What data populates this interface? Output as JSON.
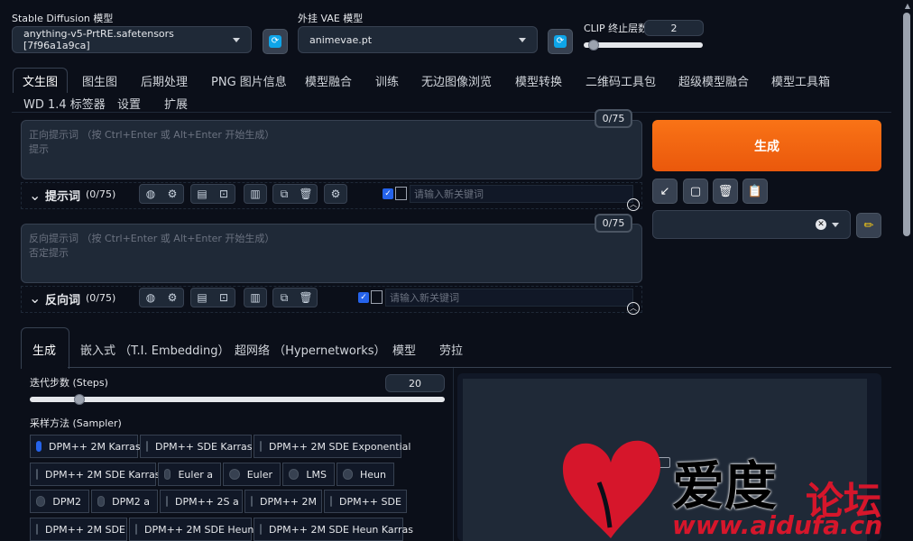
{
  "model": {
    "label": "Stable Diffusion 模型",
    "value": "anything-v5-PrtRE.safetensors [7f96a1a9ca]"
  },
  "vae": {
    "label": "外挂 VAE 模型",
    "value": "animevae.pt"
  },
  "clip": {
    "label": "CLIP 终止层数",
    "value": "2"
  },
  "tabs": [
    "文生图",
    "图生图",
    "后期处理",
    "PNG 图片信息",
    "模型融合",
    "训练",
    "无边图像浏览",
    "模型转换",
    "二维码工具包",
    "超级模型融合",
    "模型工具箱",
    "WD 1.4 标签器",
    "设置",
    "扩展"
  ],
  "prompt": {
    "placeholder_line1": "正向提示词 （按 Ctrl+Enter 或 Alt+Enter 开始生成）",
    "placeholder_line2": "提示",
    "counter": "0/75",
    "title": "提示词",
    "count": "(0/75)",
    "keyword_placeholder": "请输入新关键词"
  },
  "negative": {
    "placeholder_line1": "反向提示词 （按 Ctrl+Enter 或 Alt+Enter 开始生成）",
    "placeholder_line2": "否定提示",
    "counter": "0/75",
    "title": "反向词",
    "count": "(0/75)",
    "keyword_placeholder": "请输入新关键词"
  },
  "generate_label": "生成",
  "subtabs": [
    "生成",
    "嵌入式 （T.I. Embedding）",
    "超网络 （Hypernetworks）",
    "模型",
    "劳拉"
  ],
  "steps": {
    "label": "迭代步数 (Steps)",
    "value": "20",
    "fraction": 0.12
  },
  "sampler": {
    "label": "采样方法 (Sampler)",
    "options": [
      "DPM++ 2M Karras",
      "DPM++ SDE Karras",
      "DPM++ 2M SDE Exponential",
      "DPM++ 2M SDE Karras",
      "Euler a",
      "Euler",
      "LMS",
      "Heun",
      "DPM2",
      "DPM2 a",
      "DPM++ 2S a",
      "DPM++ 2M",
      "DPM++ SDE",
      "DPM++ 2M SDE",
      "DPM++ 2M SDE Heun",
      "DPM++ 2M SDE Heun Karras"
    ],
    "selected": "DPM++ 2M Karras"
  },
  "watermark": {
    "text1": "爱度",
    "text2": "论坛",
    "url": "www.aidufa.cn"
  },
  "colors": {
    "accent": "#f97316",
    "bg": "#0b0f19",
    "panel": "#1f2937"
  }
}
